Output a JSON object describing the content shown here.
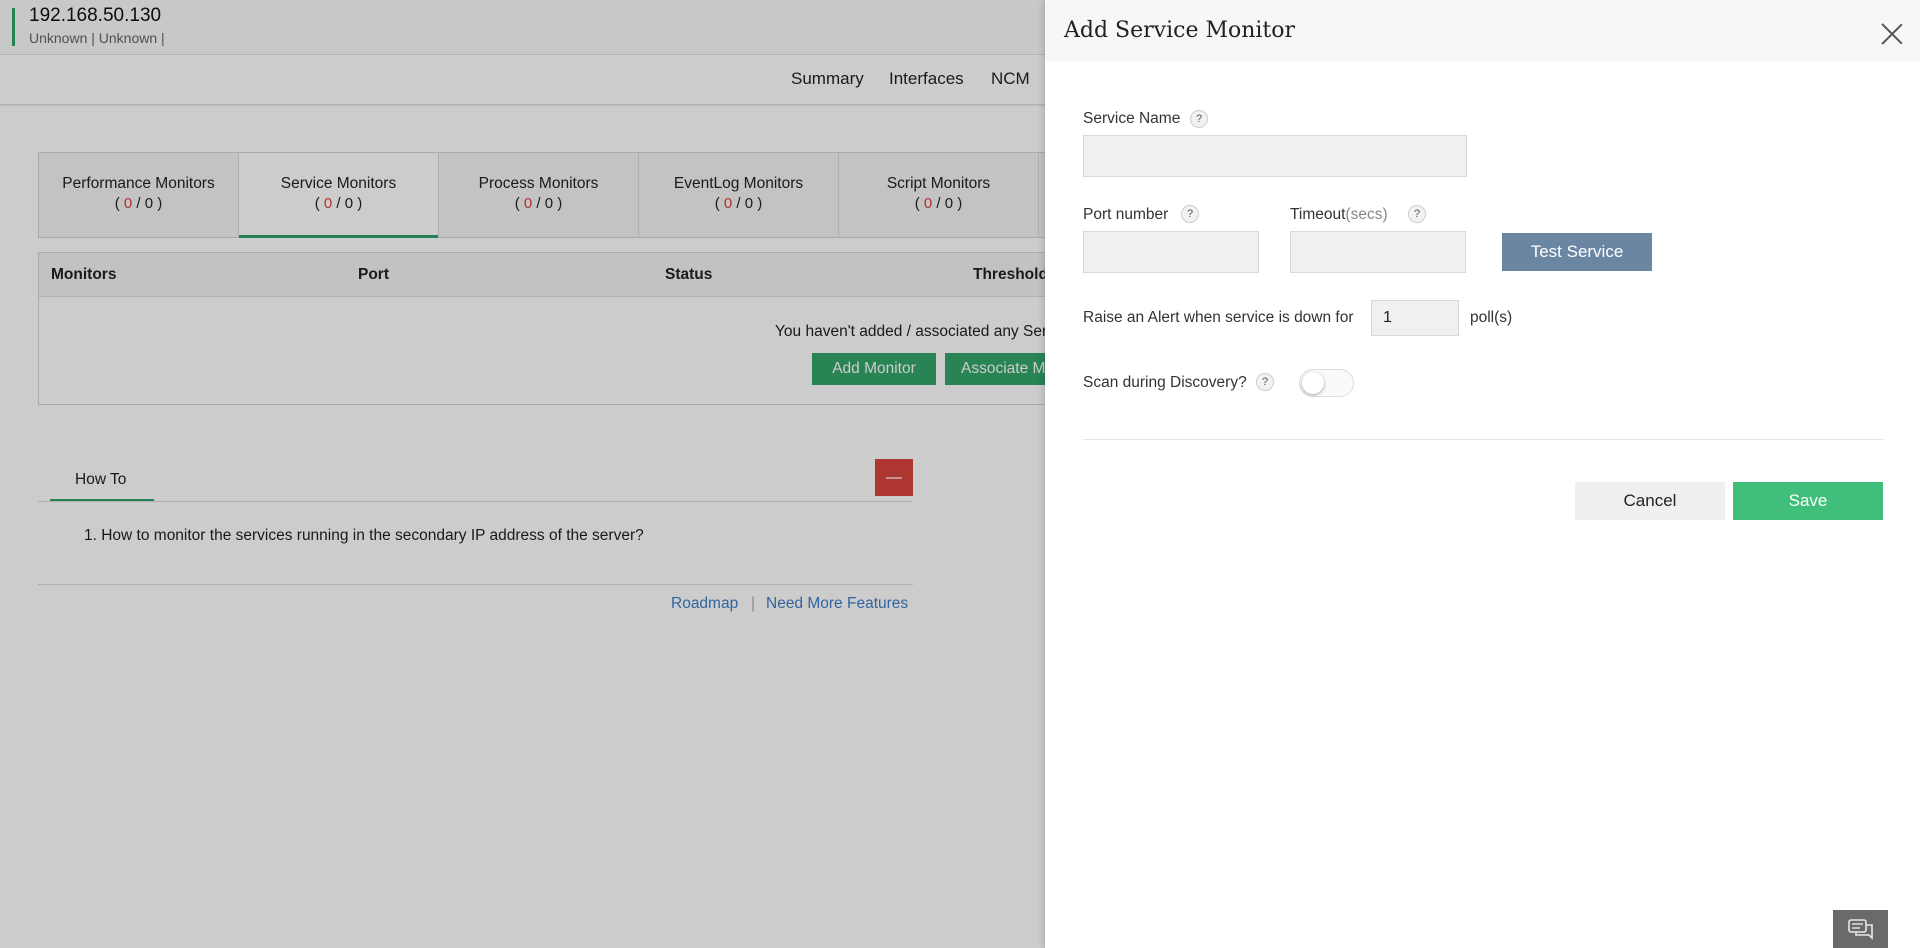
{
  "device": {
    "ip": "192.168.50.130",
    "subtitle": "Unknown | Unknown  |"
  },
  "top_nav": [
    "Summary",
    "Interfaces",
    "NCM"
  ],
  "monitor_tabs": [
    {
      "label": "Performance Monitors",
      "count_a": "0",
      "count_b": "0"
    },
    {
      "label": "Service Monitors",
      "count_a": "0",
      "count_b": "0"
    },
    {
      "label": "Process Monitors",
      "count_a": "0",
      "count_b": "0"
    },
    {
      "label": "EventLog Monitors",
      "count_a": "0",
      "count_b": "0"
    },
    {
      "label": "Script Monitors",
      "count_a": "0",
      "count_b": "0"
    }
  ],
  "table": {
    "columns": [
      "Monitors",
      "Port",
      "Status",
      "Threshold"
    ],
    "empty_message": "You haven't added / associated any Ser",
    "add_button": "Add Monitor",
    "associate_button": "Associate M"
  },
  "howto": {
    "tab_label": "How To",
    "items": [
      "1. How to monitor the services running in the secondary IP address of the server?"
    ]
  },
  "footer": {
    "roadmap": "Roadmap",
    "separator": "|",
    "more_features": "Need More Features"
  },
  "drawer": {
    "title": "Add Service Monitor",
    "service_name_label": "Service Name",
    "service_name_value": "",
    "port_label": "Port number",
    "port_value": "",
    "timeout_label": "Timeout",
    "timeout_unit": "(secs)",
    "timeout_value": "",
    "test_button": "Test Service",
    "alert_label": "Raise an Alert when service is down for",
    "alert_polls": "1",
    "alert_suffix": "poll(s)",
    "scan_label": "Scan during Discovery?",
    "scan_enabled": false,
    "help_glyph": "?",
    "cancel_button": "Cancel",
    "save_button": "Save"
  },
  "colors": {
    "accent_green": "#2fa36b",
    "save_green": "#3fbf7a",
    "test_blue": "#6b86a3",
    "count_red": "#e53935"
  }
}
